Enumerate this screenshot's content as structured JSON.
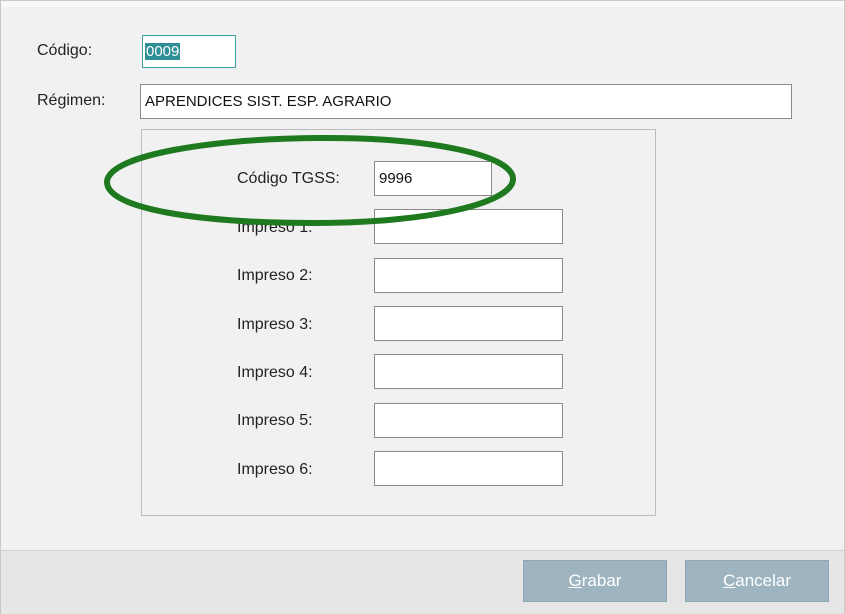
{
  "form": {
    "codigo_label": "Código:",
    "codigo_value": "0009",
    "regimen_label": "Régimen:",
    "regimen_value": "APRENDICES SIST. ESP. AGRARIO"
  },
  "tgss": {
    "label": "Código TGSS:",
    "value": "9996"
  },
  "impresos": [
    {
      "label": "Impreso 1:",
      "value": ""
    },
    {
      "label": "Impreso 2:",
      "value": ""
    },
    {
      "label": "Impreso 3:",
      "value": ""
    },
    {
      "label": "Impreso 4:",
      "value": ""
    },
    {
      "label": "Impreso 5:",
      "value": ""
    },
    {
      "label": "Impreso 6:",
      "value": ""
    }
  ],
  "buttons": {
    "grabar_first": "G",
    "grabar_rest": "rabar",
    "cancelar_first": "C",
    "cancelar_rest": "ancelar"
  },
  "colors": {
    "annotation": "#1f7a1f",
    "selection": "#2f8f97",
    "button_bg": "#9eb4c0"
  }
}
